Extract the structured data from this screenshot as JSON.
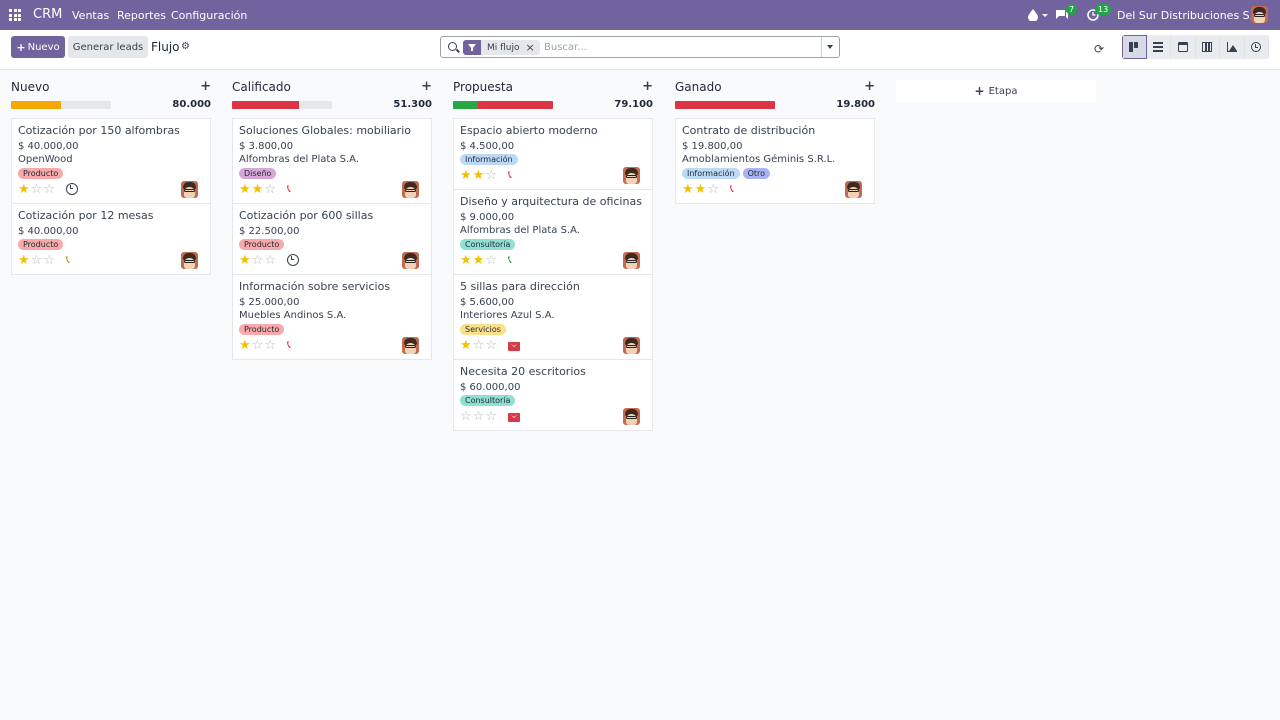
{
  "navbar": {
    "brand": "CRM",
    "menu": [
      {
        "label": "Ventas"
      },
      {
        "label": "Reportes"
      },
      {
        "label": "Configuración"
      }
    ],
    "messages_count": "7",
    "activities_count": "13",
    "company": "Del Sur Distribuciones S.A.",
    "icons": [
      "apps-grid-icon",
      "droplet-icon",
      "chat-icon",
      "clock-icon"
    ]
  },
  "control": {
    "new_label": "Nuevo",
    "generate_label": "Generar leads",
    "title": "Flujo",
    "search": {
      "facet": "Mi flujo",
      "placeholder": "Buscar..."
    }
  },
  "colors": {
    "brand": "#71639e",
    "success": "#28a745",
    "danger": "#dc3545",
    "warning": "#f5a800",
    "tag_producto": "#f8a9a9",
    "tag_diseno": "#d6a8d8",
    "tag_informacion": "#bcd9f5",
    "tag_consultoria": "#8fe0d2",
    "tag_servicios": "#fbe08a",
    "tag_otro": "#a9b4f5"
  },
  "add_stage_label": "Etapa",
  "columns": [
    {
      "title": "Nuevo",
      "total": "80.000",
      "progress": [
        {
          "color": "#f5a800",
          "pct": 50
        }
      ],
      "cards": [
        {
          "title": "Cotización por 150 alfombras",
          "amount": "$ 40.000,00",
          "partner": "OpenWood",
          "tags": [
            {
              "label": "Producto",
              "color": "#f8a9a9"
            }
          ],
          "stars": 1,
          "activity": "clock"
        },
        {
          "title": "Cotización por 12 mesas",
          "amount": "$ 40.000,00",
          "partner": "",
          "tags": [
            {
              "label": "Producto",
              "color": "#f8a9a9"
            }
          ],
          "stars": 1,
          "activity": "phone-warn"
        }
      ]
    },
    {
      "title": "Calificado",
      "total": "51.300",
      "progress": [
        {
          "color": "#dc3545",
          "pct": 67
        }
      ],
      "cards": [
        {
          "title": "Soluciones Globales: mobiliario",
          "amount": "$ 3.800,00",
          "partner": "Alfombras del Plata S.A.",
          "tags": [
            {
              "label": "Diseño",
              "color": "#d6a8d8"
            }
          ],
          "stars": 2,
          "activity": "phone-danger"
        },
        {
          "title": "Cotización por 600 sillas",
          "amount": "$ 22.500,00",
          "partner": "",
          "tags": [
            {
              "label": "Producto",
              "color": "#f8a9a9"
            }
          ],
          "stars": 1,
          "activity": "clock"
        },
        {
          "title": "Información sobre servicios",
          "amount": "$ 25.000,00",
          "partner": "Muebles Andinos S.A.",
          "tags": [
            {
              "label": "Producto",
              "color": "#f8a9a9"
            }
          ],
          "stars": 1,
          "activity": "phone-danger"
        }
      ]
    },
    {
      "title": "Propuesta",
      "total": "79.100",
      "progress": [
        {
          "color": "#28a745",
          "pct": 25
        },
        {
          "color": "#dc3545",
          "pct": 75
        }
      ],
      "cards": [
        {
          "title": "Espacio abierto moderno",
          "amount": "$ 4.500,00",
          "partner": "",
          "tags": [
            {
              "label": "Información",
              "color": "#bcd9f5"
            }
          ],
          "stars": 2,
          "activity": "phone-danger"
        },
        {
          "title": "Diseño y arquitectura de oficinas",
          "amount": "$ 9.000,00",
          "partner": "Alfombras del Plata S.A.",
          "tags": [
            {
              "label": "Consultoría",
              "color": "#8fe0d2"
            }
          ],
          "stars": 2,
          "activity": "phone-success"
        },
        {
          "title": "5 sillas para dirección",
          "amount": "$ 5.600,00",
          "partner": "Interiores Azul S.A.",
          "tags": [
            {
              "label": "Servicios",
              "color": "#fbe08a"
            }
          ],
          "stars": 1,
          "activity": "mail"
        },
        {
          "title": "Necesita 20 escritorios",
          "amount": "$ 60.000,00",
          "partner": "",
          "tags": [
            {
              "label": "Consultoría",
              "color": "#8fe0d2"
            }
          ],
          "stars": 0,
          "activity": "mail"
        }
      ]
    },
    {
      "title": "Ganado",
      "total": "19.800",
      "progress": [
        {
          "color": "#dc3545",
          "pct": 100
        }
      ],
      "cards": [
        {
          "title": "Contrato de distribución",
          "amount": "$ 19.800,00",
          "partner": "Amoblamientos Géminis S.R.L.",
          "tags": [
            {
              "label": "Información",
              "color": "#bcd9f5"
            },
            {
              "label": "Otro",
              "color": "#a9b4f5"
            }
          ],
          "stars": 2,
          "activity": "phone-danger"
        }
      ]
    }
  ]
}
